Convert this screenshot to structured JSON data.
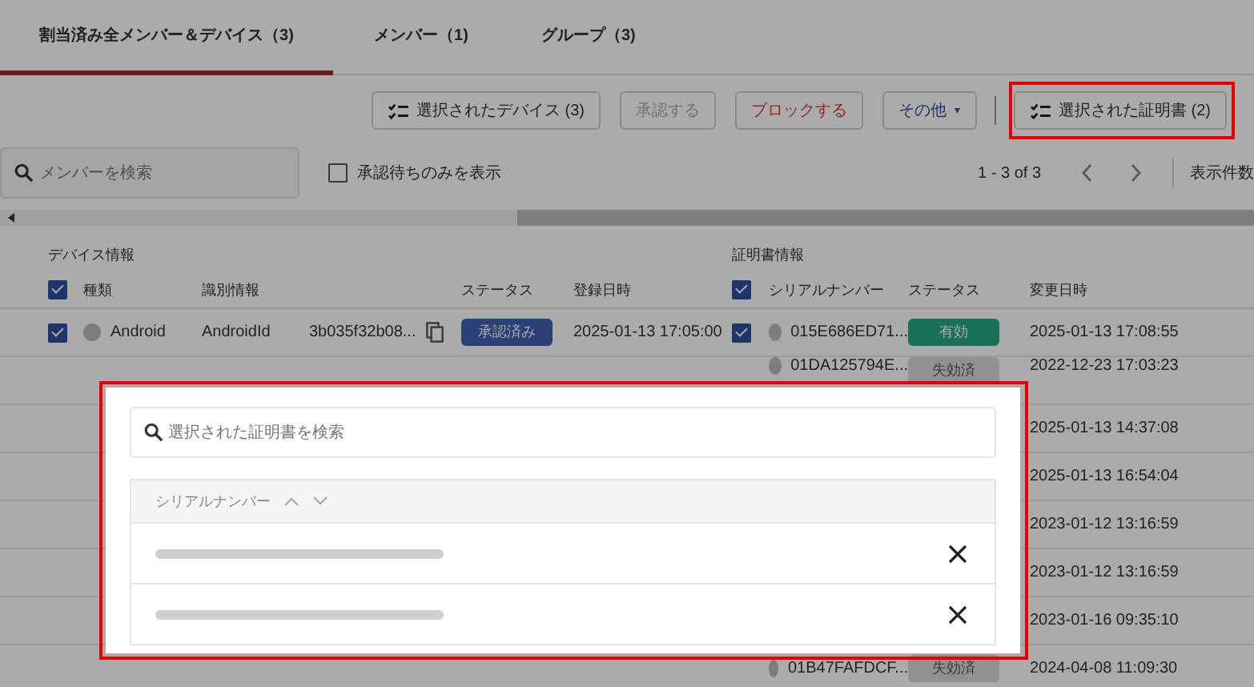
{
  "tabs": [
    {
      "label": "割当済み全メンバー＆デバイス（3)",
      "selected": true
    },
    {
      "label": "メンバー（1)",
      "selected": false
    },
    {
      "label": "グループ（3)",
      "selected": false
    }
  ],
  "toolbar": [
    {
      "kind": "list",
      "label": "選択されたデバイス (3)"
    },
    {
      "kind": "disabled",
      "label": "承認する"
    },
    {
      "kind": "danger",
      "label": "ブロックする"
    },
    {
      "kind": "menu",
      "label": "その他",
      "caret": "▾"
    },
    {
      "kind": "divider"
    },
    {
      "kind": "list",
      "label": "選択された証明書 (2)"
    }
  ],
  "search": {
    "placeholder": "メンバーを検索"
  },
  "pending_only": {
    "label": "承認待ちのみを表示",
    "checked": false
  },
  "pagination": {
    "range": "1 - 3 of 3",
    "per_page_label": "表示件数"
  },
  "device_section": "デバイス情報",
  "certificate_section": "証明書情報",
  "device_columns": {
    "all_checked": true,
    "type": "種類",
    "identifier": "識別情報",
    "status": "ステータス",
    "registered": "登録日時"
  },
  "certificate_columns": {
    "all_checked": true,
    "serial": "シリアルナンバー",
    "status": "ステータス",
    "changed": "変更日時"
  },
  "rows": [
    {
      "device": {
        "selected": true,
        "type": "Android",
        "identifier": "AndroidId",
        "id": "3b035f32b08...",
        "status": "承認済み",
        "color": "#2a4076",
        "registered": "2025-01-13 17:05:00"
      },
      "certificate": {
        "selected": true,
        "serial": "015E686ED71...",
        "status": "有効",
        "color": "#197159",
        "changed": "2025-01-13 17:08:55"
      }
    },
    {
      "certificate": {
        "serial": "01DA125794E...",
        "status": "失効済",
        "color": "#919191",
        "changed": "2022-12-23 17:03:23"
      }
    },
    {
      "certificate": {
        "changed": "2025-01-13 14:37:08"
      }
    },
    {
      "certificate": {
        "changed": "2025-01-13 16:54:04"
      }
    },
    {
      "certificate": {
        "changed": "2023-01-12 13:16:59"
      }
    },
    {
      "certificate": {
        "changed": "2023-01-12 13:16:59"
      }
    },
    {
      "certificate": {
        "changed": "2023-01-16 09:35:10"
      }
    },
    {
      "certificate": {
        "serial": "01B47FAFDCF...",
        "status": "失効済",
        "color": "#919191",
        "changed": "2024-04-08 11:09:30"
      }
    }
  ],
  "dialog": {
    "search_placeholder": "選択された証明書を検索",
    "column": "シリアルナンバー",
    "items": [
      {
        "kind": "blurred"
      },
      {
        "kind": "blurred"
      }
    ]
  }
}
